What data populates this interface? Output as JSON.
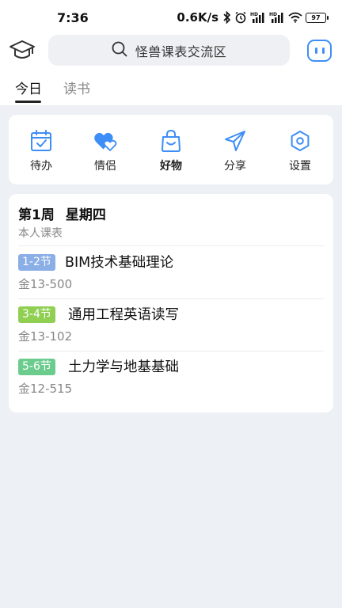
{
  "status_bar": {
    "time": "7:36",
    "speed": "0.6K/s",
    "battery": "97",
    "icons": [
      "bluetooth-icon",
      "alarm-icon",
      "signal-hd-icon",
      "signal-hd-icon",
      "wifi-icon",
      "battery-icon"
    ]
  },
  "header": {
    "search_text": "怪兽课表交流区",
    "left_icon": "graduation-cap-icon",
    "right_icon": "chat-icon"
  },
  "tabs": [
    {
      "label": "今日",
      "active": true
    },
    {
      "label": "读书",
      "active": false
    }
  ],
  "quick_actions": [
    {
      "label": "待办",
      "icon": "calendar-check-icon"
    },
    {
      "label": "情侣",
      "icon": "hearts-icon"
    },
    {
      "label": "好物",
      "icon": "shopping-bag-icon"
    },
    {
      "label": "分享",
      "icon": "send-icon"
    },
    {
      "label": "设置",
      "icon": "hexagon-settings-icon"
    }
  ],
  "schedule": {
    "week": "第1周",
    "day": "星期四",
    "subtitle": "本人课表",
    "courses": [
      {
        "period": "1-2节",
        "name": "BIM技术基础理论",
        "room": "金13-500",
        "color": "#8aaee6"
      },
      {
        "period": "3-4节",
        "name": "通用工程英语读写",
        "room": "金13-102",
        "color": "#8fcf52"
      },
      {
        "period": "5-6节",
        "name": "土力学与地基基础",
        "room": "金12-515",
        "color": "#6ccc8e"
      }
    ]
  },
  "colors": {
    "accent": "#3d8ef6",
    "background": "#edf0f4"
  }
}
